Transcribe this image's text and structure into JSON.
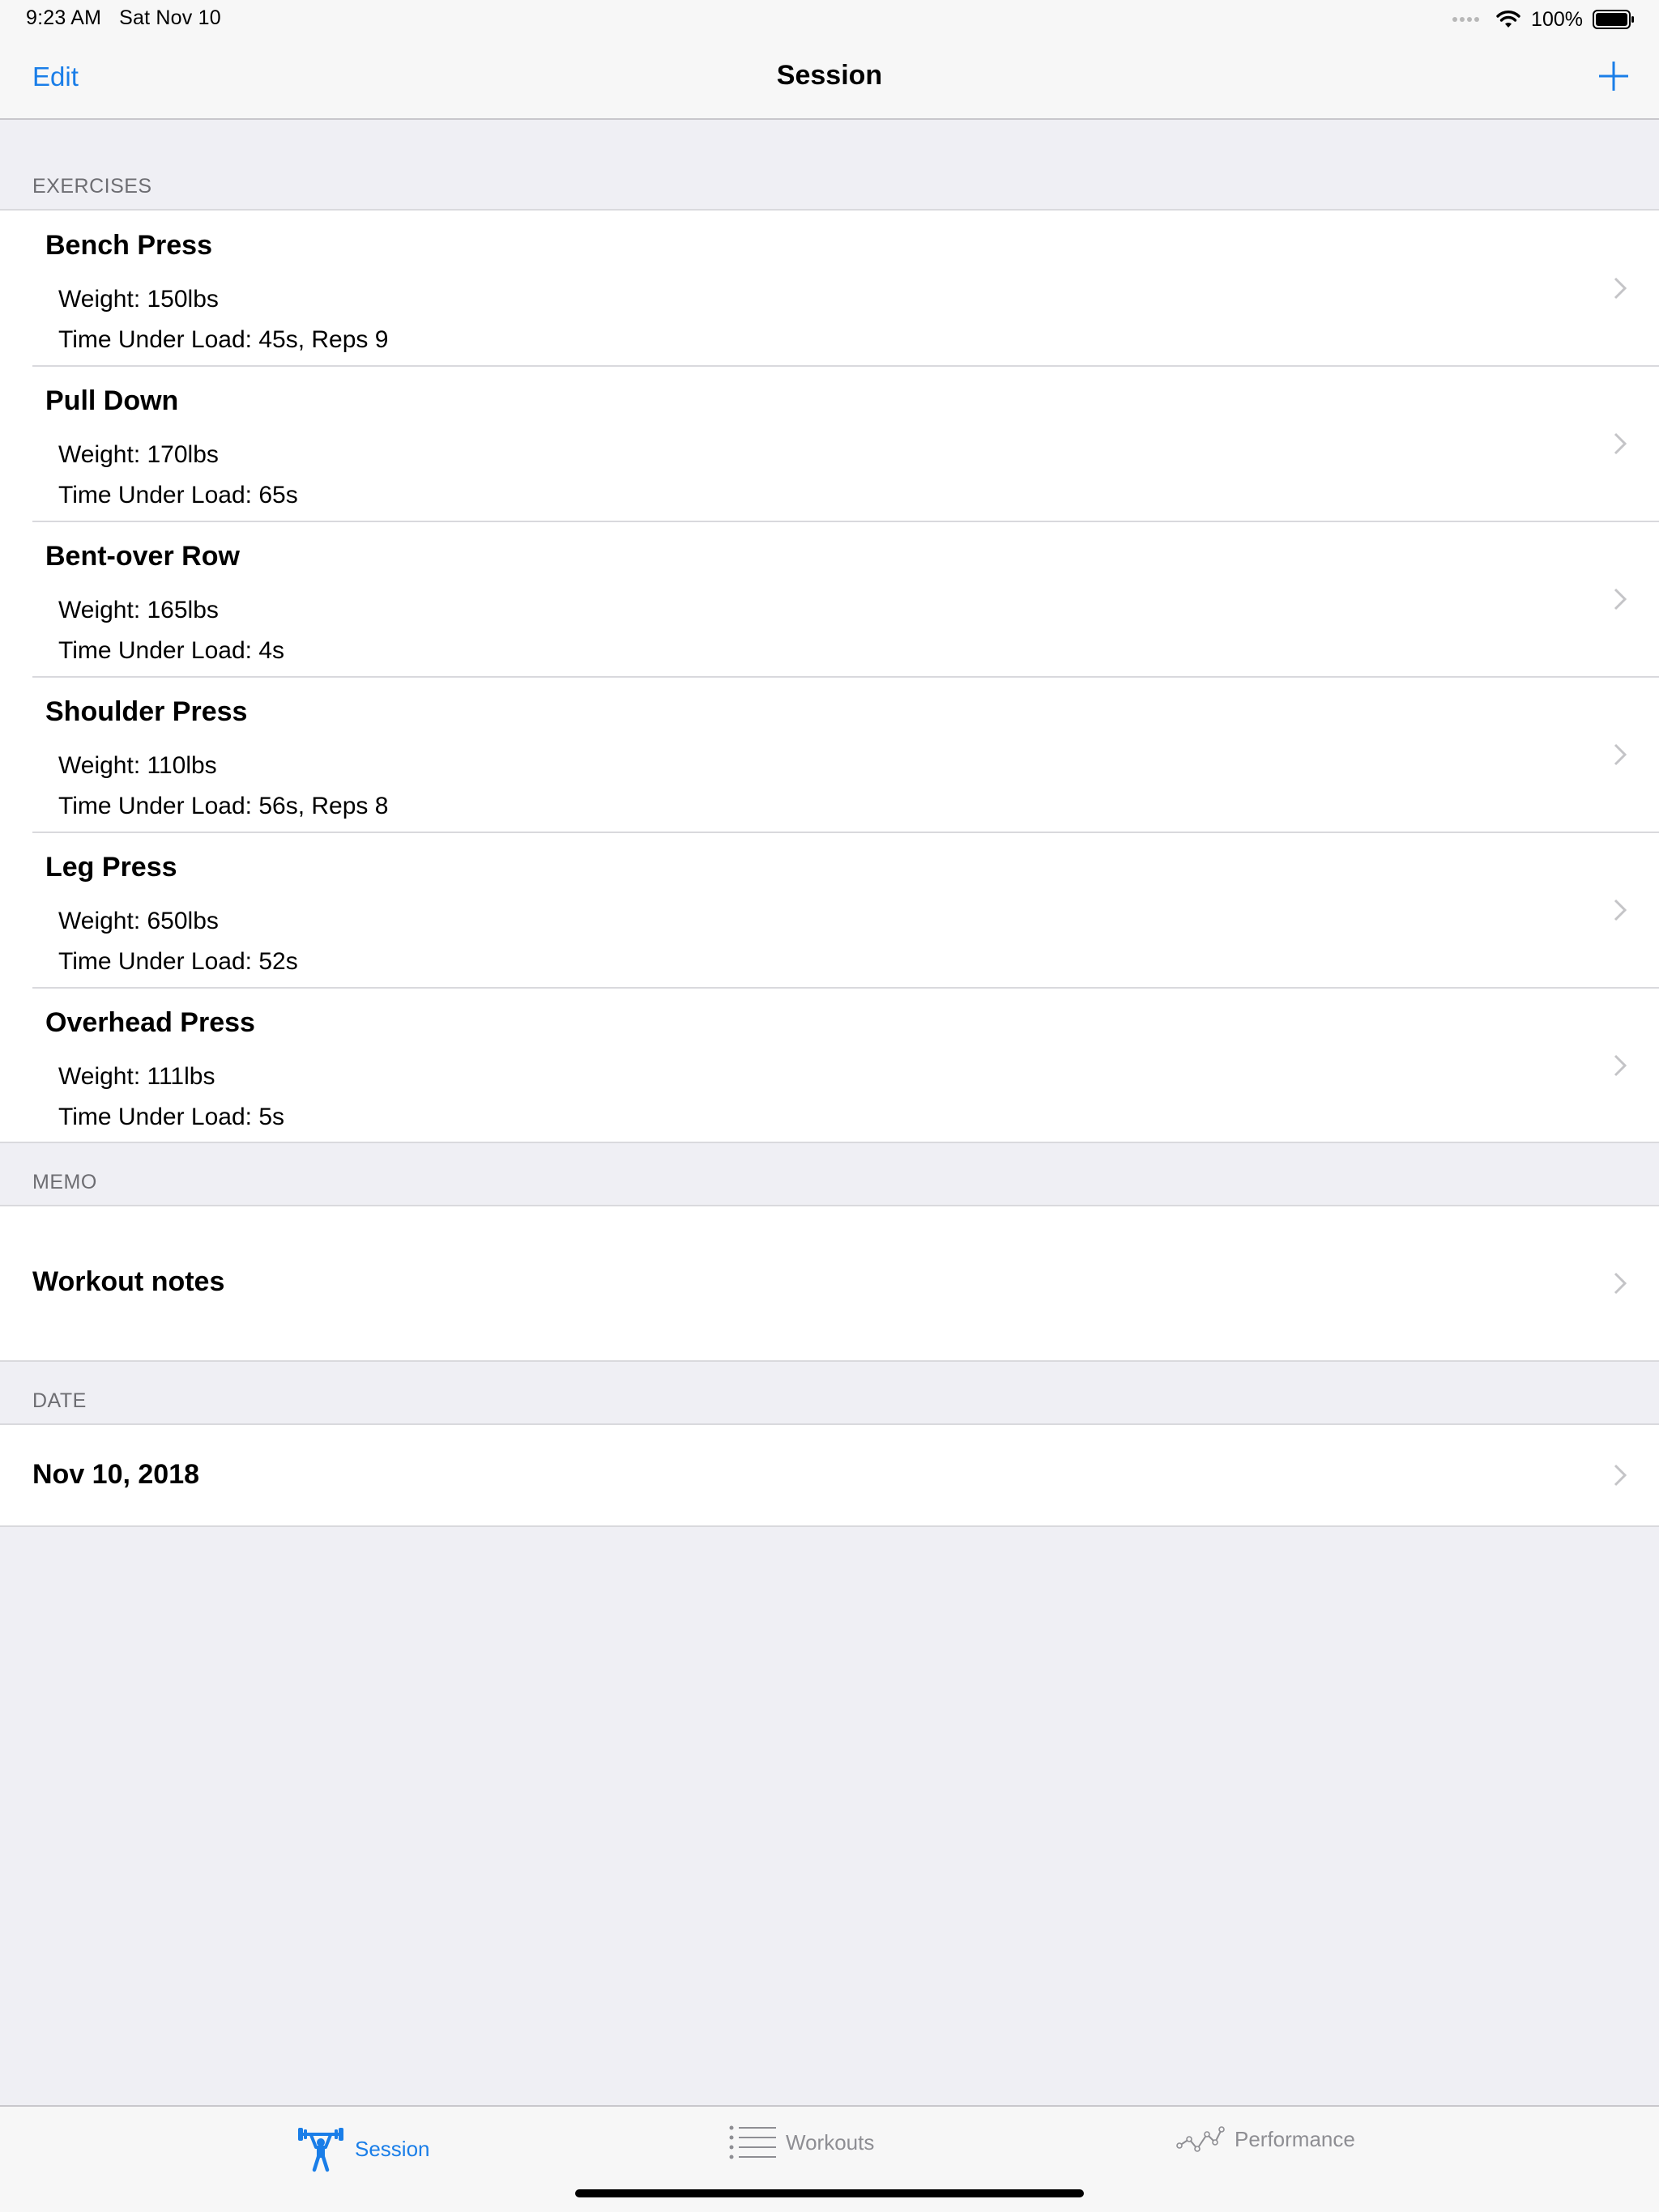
{
  "status_bar": {
    "time": "9:23 AM",
    "date": "Sat Nov 10",
    "battery": "100%"
  },
  "nav": {
    "edit_label": "Edit",
    "title": "Session"
  },
  "sections": {
    "exercises_header": "EXERCISES",
    "memo_header": "MEMO",
    "date_header": "DATE"
  },
  "exercises": [
    {
      "name": "Bench Press",
      "weight": "Weight: 150lbs",
      "time": "Time Under Load: 45s, Reps 9"
    },
    {
      "name": "Pull Down",
      "weight": "Weight: 170lbs",
      "time": "Time Under Load: 65s"
    },
    {
      "name": "Bent-over Row",
      "weight": "Weight: 165lbs",
      "time": "Time Under Load: 4s"
    },
    {
      "name": "Shoulder Press",
      "weight": "Weight: 110lbs",
      "time": "Time Under Load: 56s, Reps 8"
    },
    {
      "name": "Leg Press",
      "weight": "Weight: 650lbs",
      "time": "Time Under Load: 52s"
    },
    {
      "name": "Overhead Press",
      "weight": "Weight: 111lbs",
      "time": "Time Under Load: 5s"
    }
  ],
  "memo": {
    "label": "Workout notes"
  },
  "date": {
    "label": "Nov 10, 2018"
  },
  "tabs": [
    {
      "label": "Session",
      "icon": "weightlifter-icon",
      "active": true
    },
    {
      "label": "Workouts",
      "icon": "list-icon",
      "active": false
    },
    {
      "label": "Performance",
      "icon": "line-chart-icon",
      "active": false
    }
  ],
  "colors": {
    "accent": "#1a7ee8",
    "background": "#efeff4",
    "inactive_tab": "#8e8e93"
  }
}
